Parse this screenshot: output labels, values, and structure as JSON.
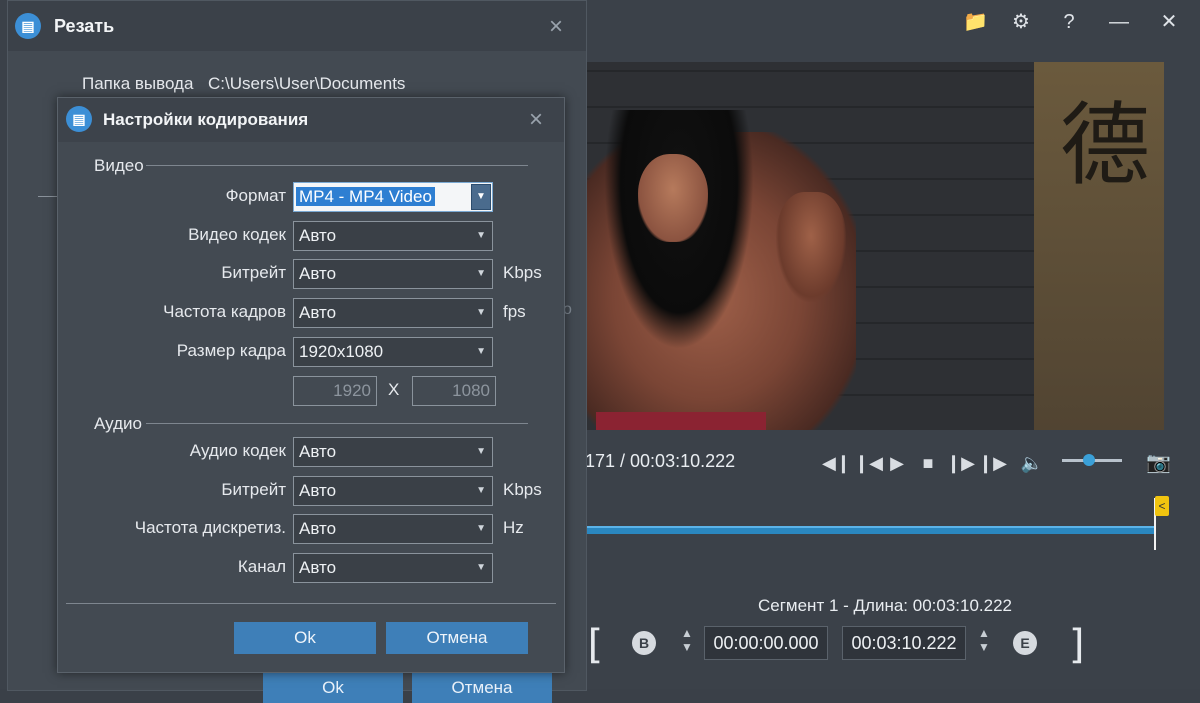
{
  "main_window": {
    "time_readout": "171 / 00:03:10.222",
    "segment_label": "Сегмент 1 - Длина: 00:03:10.222",
    "start_time": "00:00:00.000",
    "end_time": "00:03:10.222",
    "begin_marker": "B",
    "end_marker": "E",
    "volume_level_fraction": 0.45,
    "timeline_flag": "<",
    "video_overlay_glyph": "德"
  },
  "cut_dialog": {
    "title": "Резать",
    "output_folder_label": "Папка вывода",
    "output_folder_path": "C:\\Users\\User\\Documents",
    "ok_label": "Ok",
    "cancel_label": "Отмена",
    "ghost_text": "o"
  },
  "encoding_dialog": {
    "title": "Настройки кодирования",
    "video_section": "Видео",
    "audio_section": "Аудио",
    "format_label": "Формат",
    "format_value": "MP4 - MP4 Video",
    "video_codec_label": "Видео кодек",
    "video_codec_value": "Авто",
    "video_bitrate_label": "Битрейт",
    "video_bitrate_value": "Авто",
    "video_bitrate_unit": "Kbps",
    "framerate_label": "Частота кадров",
    "framerate_value": "Авто",
    "framerate_unit": "fps",
    "frame_size_label": "Размер кадра",
    "frame_size_value": "1920x1080",
    "width_value": "1920",
    "height_value": "1080",
    "size_separator": "X",
    "audio_codec_label": "Аудио кодек",
    "audio_codec_value": "Авто",
    "audio_bitrate_label": "Битрейт",
    "audio_bitrate_value": "Авто",
    "audio_bitrate_unit": "Kbps",
    "samplerate_label": "Частота дискретиз.",
    "samplerate_value": "Авто",
    "samplerate_unit": "Hz",
    "channel_label": "Канал",
    "channel_value": "Авто",
    "ok_label": "Ok",
    "cancel_label": "Отмена"
  },
  "colors": {
    "accent_blue": "#3e7fb8",
    "selection_blue": "#2e7fd2",
    "timeline_blue": "#2a87c0",
    "flag_yellow": "#f1c40f"
  }
}
